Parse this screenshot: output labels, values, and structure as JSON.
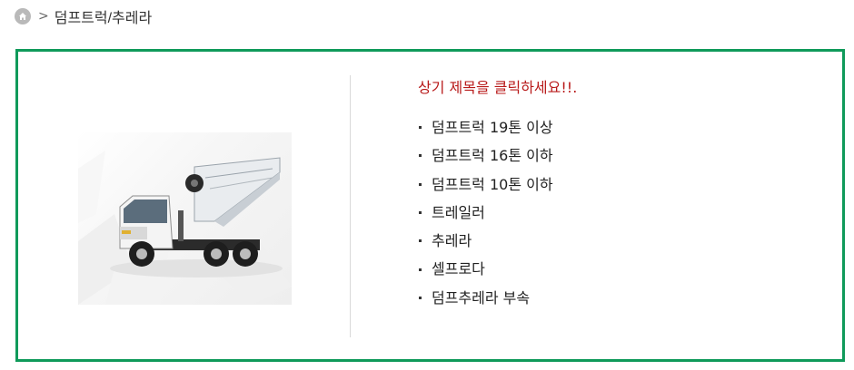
{
  "breadcrumb": {
    "home_icon": "home-icon",
    "separator": ">",
    "current": "덤프트럭/추레라"
  },
  "notice": "상기 제목을 클릭하세요!!.",
  "menu": {
    "items": [
      {
        "label": "덤프트럭 19톤 이상"
      },
      {
        "label": "덤프트럭 16톤 이하"
      },
      {
        "label": "덤프트럭 10톤 이하"
      },
      {
        "label": "트레일러"
      },
      {
        "label": "추레라"
      },
      {
        "label": "셀프로다"
      },
      {
        "label": "덤프추레라 부속"
      }
    ]
  },
  "colors": {
    "panel_border": "#0f9a5a",
    "notice_text": "#b81a1a"
  }
}
